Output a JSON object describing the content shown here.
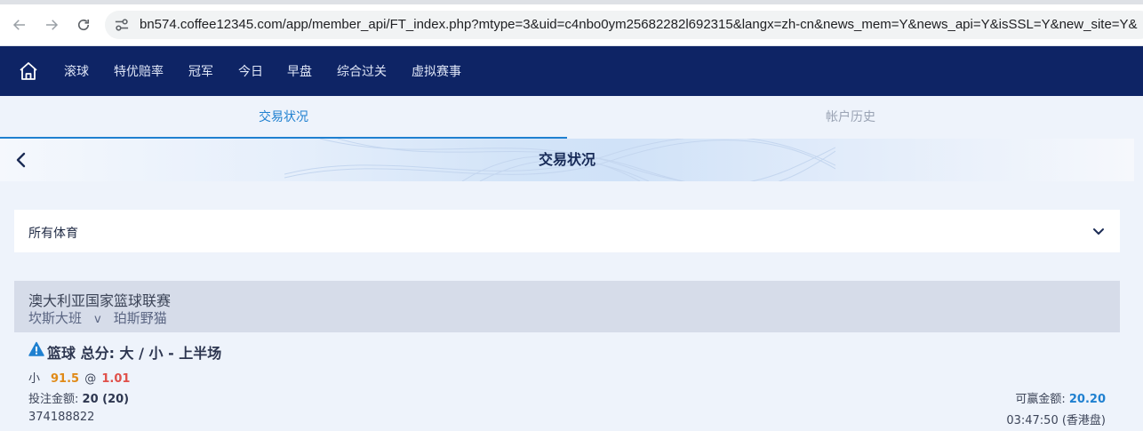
{
  "browser": {
    "url": "bn574.coffee12345.com/app/member_api/FT_index.php?mtype=3&uid=c4nbo0ym25682282l692315&langx=zh-cn&news_mem=Y&news_api=Y&isSSL=Y&new_site=Y&"
  },
  "nav": {
    "items": [
      {
        "label": "滚球"
      },
      {
        "label": "特优赔率"
      },
      {
        "label": "冠军"
      },
      {
        "label": "今日"
      },
      {
        "label": "早盘"
      },
      {
        "label": "综合过关"
      },
      {
        "label": "虚拟赛事"
      }
    ]
  },
  "tabs": [
    {
      "label": "交易状况",
      "active": true
    },
    {
      "label": "帐户历史",
      "active": false
    }
  ],
  "banner": {
    "title": "交易状况"
  },
  "sport_filter": {
    "selected": "所有体育"
  },
  "bet": {
    "league": "澳大利亚国家篮球联赛",
    "home_team": "坎斯大班",
    "vs": "v",
    "away_team": "珀斯野猫",
    "bet_type": "篮球 总分: 大 / 小 - 上半场",
    "selection": "小",
    "handicap": "91.5",
    "at": "@",
    "odds": "1.01",
    "stake_label": "投注金额:",
    "stake_value": "20 (20)",
    "win_label": "可赢金额:",
    "win_value": "20.20",
    "ticket_id": "374188822",
    "time": "03:47:50 (香港盘)"
  },
  "colors": {
    "nav_bg": "#0e2465",
    "accent": "#1f80d0",
    "handicap": "#e08a17",
    "odds": "#e0504a",
    "warning": "#1f80d0"
  }
}
